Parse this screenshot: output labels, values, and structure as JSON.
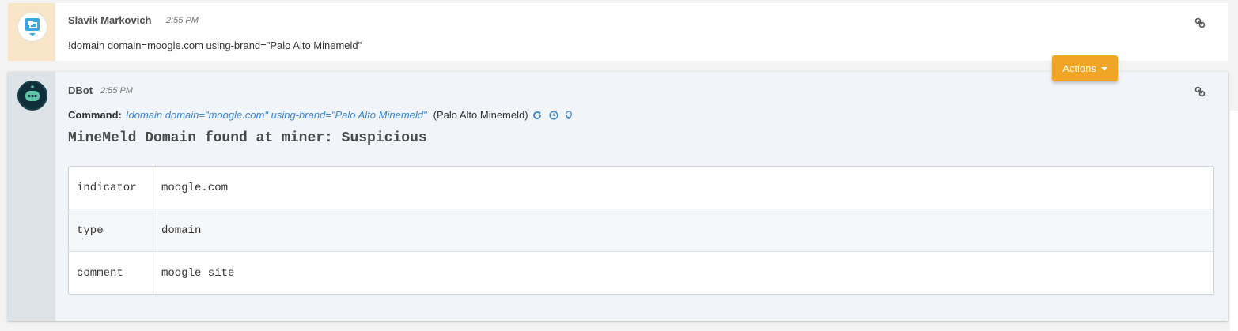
{
  "messages": [
    {
      "sender": "Slavik Markovich",
      "time": "2:55 PM",
      "text": "!domain domain=moogle.com using-brand=\"Palo Alto Minemeld\""
    },
    {
      "sender": "DBot",
      "time": "2:55 PM",
      "command_label": "Command:",
      "command_text": "!domain domain=\"moogle.com\" using-brand=\"Palo Alto Minemeld\"",
      "command_brand": "(Palo Alto Minemeld)",
      "result_title": "MineMeld Domain found at miner: Suspicious",
      "table": [
        {
          "key": "indicator",
          "value": "moogle.com"
        },
        {
          "key": "type",
          "value": "domain"
        },
        {
          "key": "comment",
          "value": "moogle site"
        }
      ]
    }
  ],
  "actions_button": {
    "label": "Actions"
  },
  "icons": {
    "user_avatar": "chat-bubble-icon",
    "bot_avatar": "robot-icon",
    "permalink": "link-icon",
    "rerun": "refresh-icon",
    "history": "clock-icon",
    "tip": "lightbulb-icon"
  },
  "colors": {
    "accent": "#f0a524",
    "command_link": "#3a86d4",
    "user_gutter": "#f8e5c8",
    "bot_gutter": "#dde3e6",
    "bot_avatar_bg": "#0d2e3a",
    "user_avatar_icon": "#3ba8e0",
    "bot_avatar_icon": "#5fc5a8"
  }
}
